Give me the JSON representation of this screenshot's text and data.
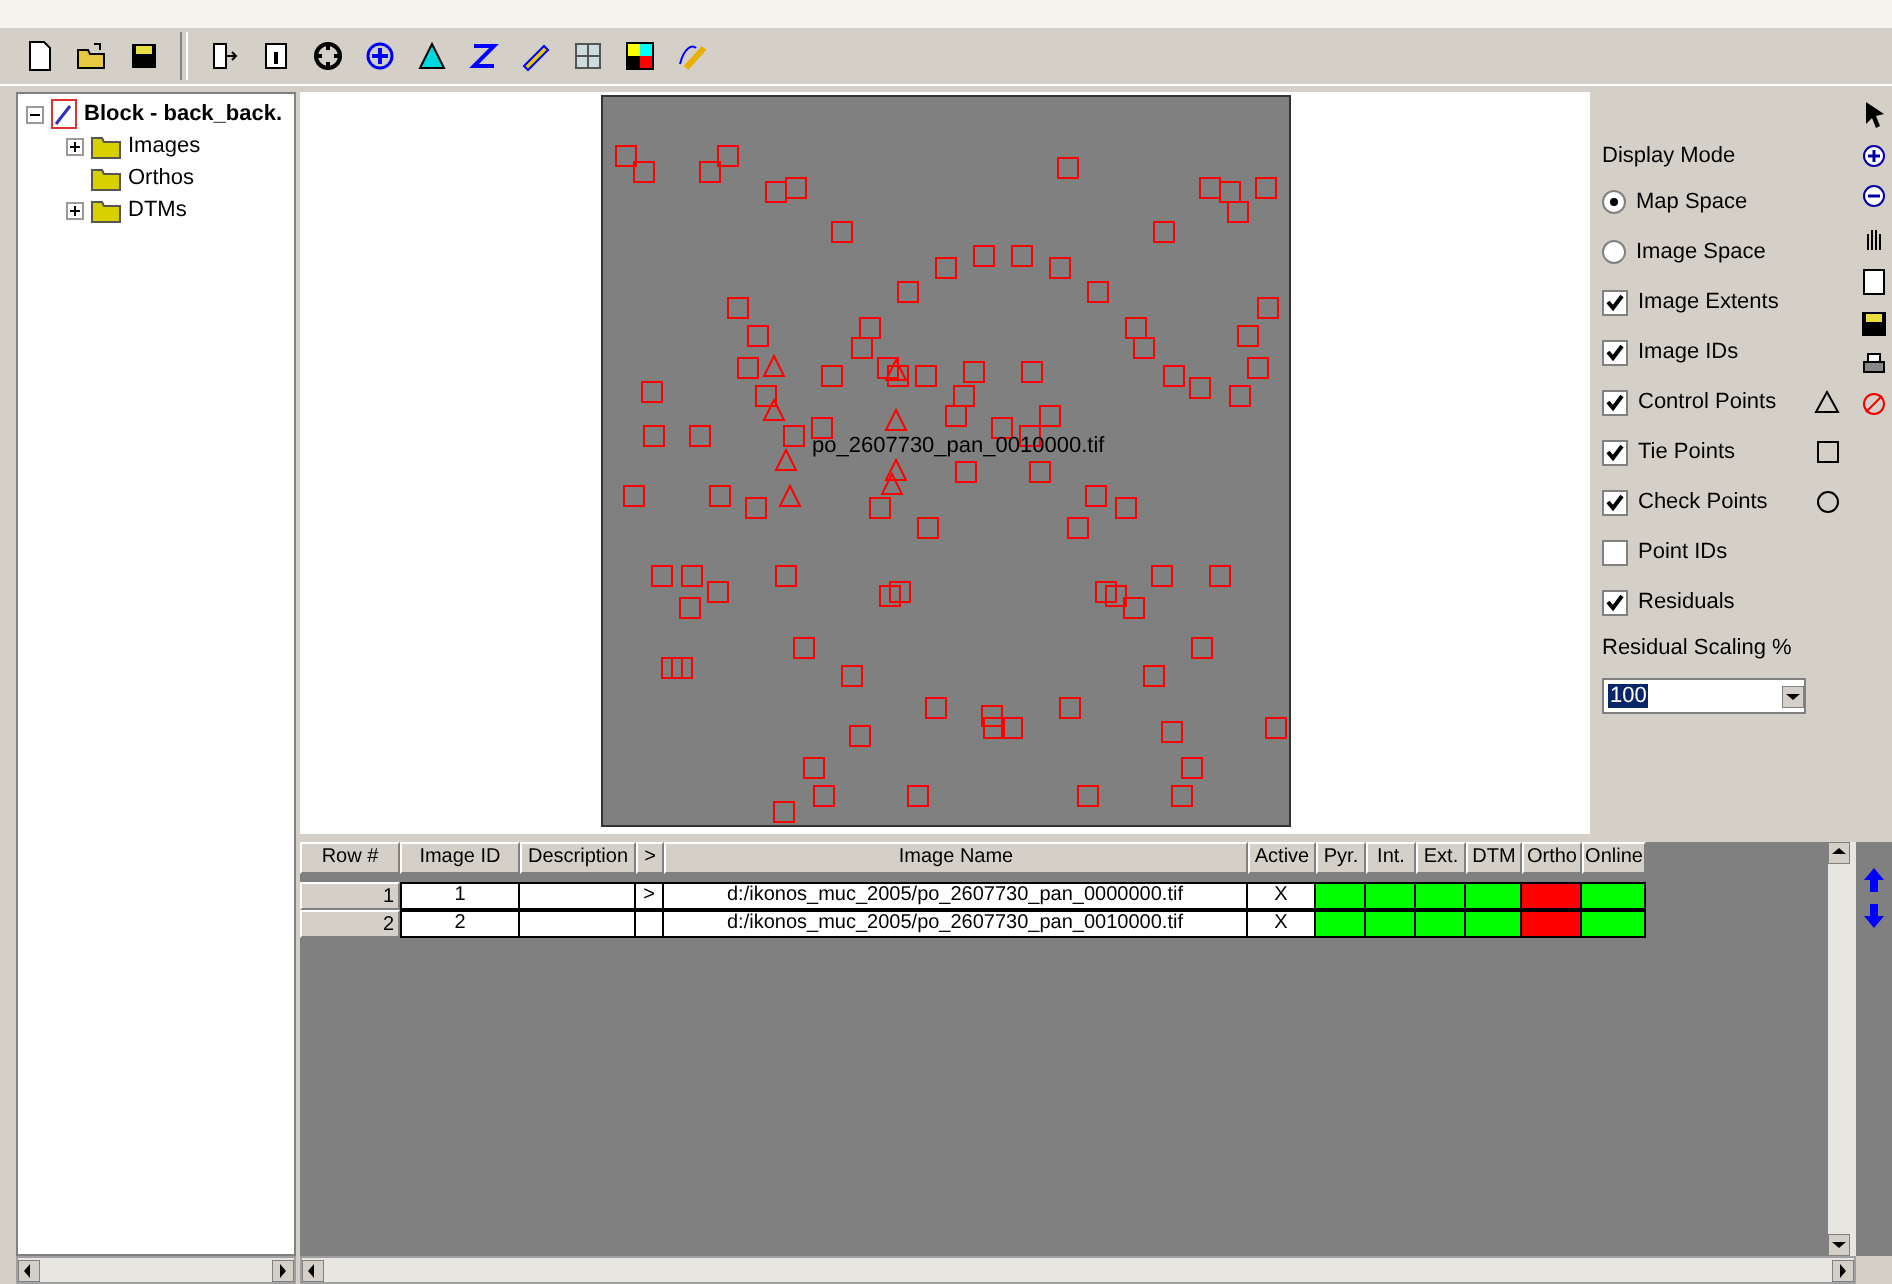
{
  "tree": {
    "label": "Block - back_back.",
    "expanded": true,
    "children": [
      {
        "label": "Images",
        "expanded": false
      },
      {
        "label": "Orthos"
      },
      {
        "label": "DTMs",
        "expanded": false
      }
    ]
  },
  "map": {
    "image_label": "po_2607730_pan_0010000.tif"
  },
  "options": {
    "display_mode_label": "Display Mode",
    "modes": [
      {
        "label": "Map Space",
        "selected": true
      },
      {
        "label": "Image Space",
        "selected": false
      }
    ],
    "layers": [
      {
        "label": "Image Extents",
        "checked": true
      },
      {
        "label": "Image IDs",
        "checked": true
      },
      {
        "label": "Control Points",
        "checked": true,
        "kind": "triangle"
      },
      {
        "label": "Tie Points",
        "checked": true,
        "kind": "square"
      },
      {
        "label": "Check Points",
        "checked": true,
        "kind": "circle"
      },
      {
        "label": "Point IDs",
        "checked": false
      },
      {
        "label": "Residuals",
        "checked": true
      }
    ],
    "residual_label": "Residual Scaling %",
    "residual_value": "100"
  },
  "table": {
    "columns": [
      "Row #",
      "Image ID",
      "Description",
      ">",
      "Image Name",
      "Active",
      "Pyr.",
      "Int.",
      "Ext.",
      "DTM",
      "Ortho",
      "Online"
    ],
    "rows": [
      {
        "row": "1",
        "image_id": "1",
        "marker": ">",
        "image_name": "d:/ikonos_muc_2005/po_2607730_pan_0000000.tif",
        "active": "X",
        "statuses": [
          {
            "color": "#00ff00"
          },
          {
            "color": "#00ff00"
          },
          {
            "color": "#00ff00"
          },
          {
            "color": "#00ff00"
          },
          {
            "color": "#ff0000"
          },
          {
            "color": "#00ff00"
          }
        ]
      },
      {
        "row": "2",
        "image_id": "2",
        "image_name": "d:/ikonos_muc_2005/po_2607730_pan_0010000.tif",
        "active": "X",
        "statuses": [
          {
            "color": "#00ff00"
          },
          {
            "color": "#00ff00"
          },
          {
            "color": "#00ff00"
          },
          {
            "color": "#00ff00"
          },
          {
            "color": "#ff0000"
          },
          {
            "color": "#00ff00"
          }
        ]
      }
    ]
  }
}
